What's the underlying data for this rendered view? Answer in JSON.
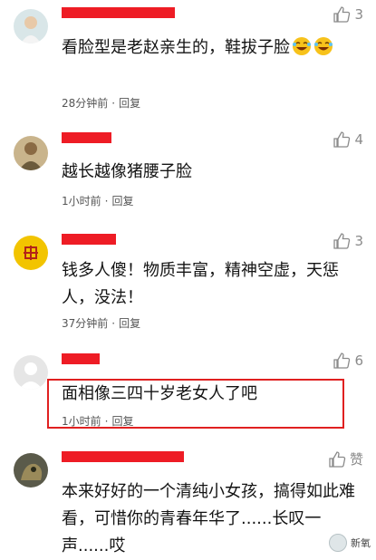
{
  "comments": [
    {
      "username": "",
      "text": "看脸型是老赵亲生的，鞋拔子脸",
      "time": "28分钟前",
      "reply": "回复",
      "likes": "3",
      "emoji_count": 2
    },
    {
      "username": "",
      "text": "越长越像猪腰子脸",
      "time": "1小时前",
      "reply": "回复",
      "likes": "4"
    },
    {
      "username": "",
      "text": "钱多人傻！物质丰富，精神空虚，天惩人，没法！",
      "time": "37分钟前",
      "reply": "回复",
      "likes": "3"
    },
    {
      "username": "",
      "text": "面相像三四十岁老女人了吧",
      "time": "1小时前",
      "reply": "回复",
      "likes": "6"
    },
    {
      "username": "",
      "text": "本来好好的一个清纯小女孩，搞得如此难看，可惜你的青春年华了......长叹一声......哎",
      "time": "",
      "reply": "",
      "likes": "赞"
    }
  ],
  "meta_separator": "·",
  "watermark": "新氧",
  "colors": {
    "redact": "#ee1c25",
    "highlight": "#e02020",
    "muted": "#8a8a8a"
  }
}
